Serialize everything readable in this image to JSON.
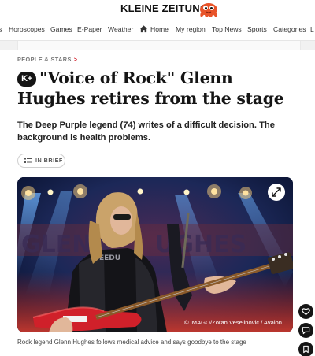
{
  "brand": {
    "logo_text": "KLEINE ZEITUNG",
    "mascot_icon": "octopus-mascot-icon",
    "accent_color": "#d4202c"
  },
  "nav": {
    "items": [
      {
        "label": "s",
        "name": "nav-item-cut"
      },
      {
        "label": "Horoscopes",
        "name": "nav-item-horoscopes"
      },
      {
        "label": "Games",
        "name": "nav-item-games"
      },
      {
        "label": "E-Paper",
        "name": "nav-item-epaper"
      },
      {
        "label": "Weather",
        "name": "nav-item-weather"
      },
      {
        "label": "Home",
        "name": "nav-item-home"
      },
      {
        "label": "My region",
        "name": "nav-item-my-region"
      },
      {
        "label": "Top News",
        "name": "nav-item-top-news"
      },
      {
        "label": "Sports",
        "name": "nav-item-sports"
      },
      {
        "label": "Categories",
        "name": "nav-item-categories"
      },
      {
        "label": "L",
        "name": "nav-item-cut-right"
      }
    ]
  },
  "article": {
    "kicker": "PEOPLE & STARS",
    "kicker_arrow": ">",
    "premium_badge": "K+",
    "headline": "\"Voice of Rock\" Glenn Hughes retires from the stage",
    "teaser": "The Deep Purple legend (74) writes of a difficult decision. The background is health problems.",
    "in_brief_label": "IN BRIEF",
    "image_credit": "© IMAGO/Zoran Veselinovic / Avalon",
    "caption": "Rock legend Glenn Hughes follows medical advice and says goodbye to the stage"
  },
  "floating_actions": [
    {
      "name": "like-button",
      "icon": "heart-icon"
    },
    {
      "name": "comments-button",
      "icon": "comment-icon"
    },
    {
      "name": "bookmark-button",
      "icon": "bookmark-icon"
    }
  ]
}
